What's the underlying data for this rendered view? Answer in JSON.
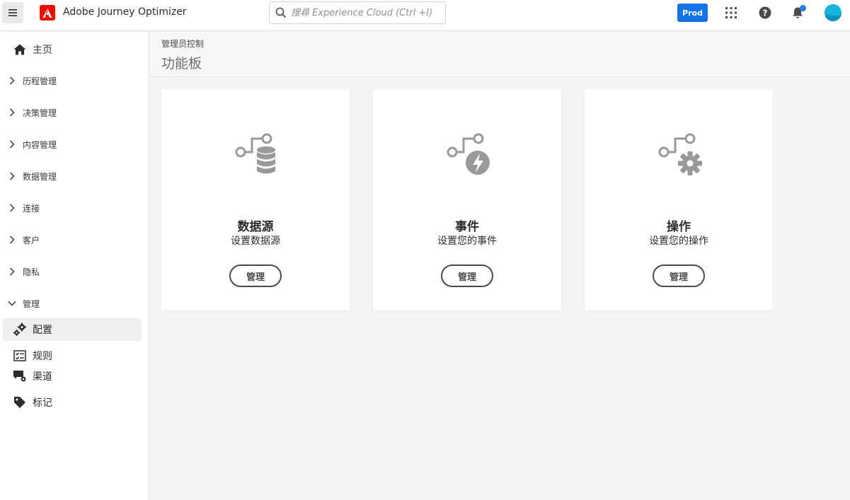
{
  "app": {
    "title": "Adobe Journey Optimizer"
  },
  "search": {
    "placeholder": "搜尋 Experience Cloud (Ctrl +I)"
  },
  "topbar": {
    "env_label": "Prod"
  },
  "sidebar": {
    "home": "主页",
    "sections": [
      {
        "label": "历程管理",
        "expanded": false
      },
      {
        "label": "决策管理",
        "expanded": false
      },
      {
        "label": "内容管理",
        "expanded": false
      },
      {
        "label": "数据管理",
        "expanded": false
      },
      {
        "label": "连接",
        "expanded": false
      },
      {
        "label": "客户",
        "expanded": false
      },
      {
        "label": "隐私",
        "expanded": false
      },
      {
        "label": "管理",
        "expanded": true
      }
    ],
    "admin_items": [
      {
        "label": "配置",
        "icon": "gears-icon",
        "selected": true
      },
      {
        "label": "规则",
        "icon": "checklist-icon",
        "selected": false
      },
      {
        "label": "渠道",
        "icon": "channel-icon",
        "selected": false
      },
      {
        "label": "标记",
        "icon": "tag-icon",
        "selected": false
      }
    ]
  },
  "main": {
    "breadcrumb": "管理员控制",
    "title": "功能板",
    "cards": [
      {
        "title": "数据源",
        "description": "设置数据源",
        "button": "管理",
        "icon": "datasource-icon"
      },
      {
        "title": "事件",
        "description": "设置您的事件",
        "button": "管理",
        "icon": "event-icon"
      },
      {
        "title": "操作",
        "description": "设置您的操作",
        "button": "管理",
        "icon": "action-icon"
      }
    ]
  },
  "colors": {
    "accent": "#1473e6",
    "adobe_red": "#eb1000",
    "notification_dot": "#2680eb"
  }
}
